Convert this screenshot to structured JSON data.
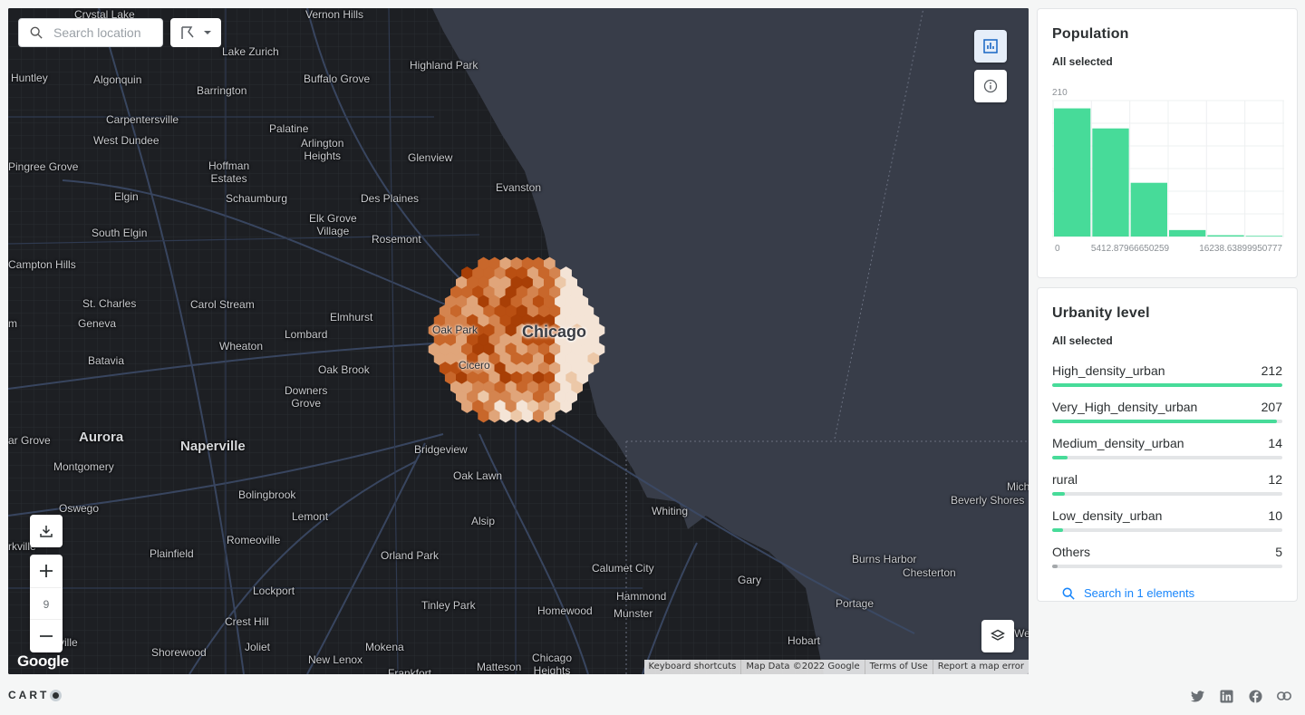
{
  "map": {
    "search_placeholder": "Search location",
    "zoom_level": "9",
    "attribution": [
      "Keyboard shortcuts",
      "Map Data ©2022 Google",
      "Terms of Use",
      "Report a map error"
    ],
    "google_logo": "Google",
    "places": [
      {
        "name": "Crystal Lake",
        "type": "normal"
      },
      {
        "name": "Vernon Hills",
        "type": "normal"
      },
      {
        "name": "Lake Zurich",
        "type": "normal"
      },
      {
        "name": "Highland Park",
        "type": "normal"
      },
      {
        "name": "Huntley",
        "type": "normal"
      },
      {
        "name": "Algonquin",
        "type": "normal"
      },
      {
        "name": "Barrington",
        "type": "normal"
      },
      {
        "name": "Buffalo Grove",
        "type": "normal"
      },
      {
        "name": "Carpentersville",
        "type": "normal"
      },
      {
        "name": "Palatine",
        "type": "normal"
      },
      {
        "name": "West Dundee",
        "type": "normal"
      },
      {
        "name": "Arlington Heights",
        "type": "normal"
      },
      {
        "name": "Glenview",
        "type": "normal"
      },
      {
        "name": "Pingree Grove",
        "type": "normal"
      },
      {
        "name": "Hoffman Estates",
        "type": "normal"
      },
      {
        "name": "Evanston",
        "type": "normal"
      },
      {
        "name": "Elgin",
        "type": "normal"
      },
      {
        "name": "Schaumburg",
        "type": "normal"
      },
      {
        "name": "Des Plaines",
        "type": "normal"
      },
      {
        "name": "Elk Grove Village",
        "type": "normal"
      },
      {
        "name": "South Elgin",
        "type": "normal"
      },
      {
        "name": "Rosemont",
        "type": "normal"
      },
      {
        "name": "Campton Hills",
        "type": "normal"
      },
      {
        "name": "St. Charles",
        "type": "normal"
      },
      {
        "name": "Carol Stream",
        "type": "normal"
      },
      {
        "name": "Elmhurst",
        "type": "normal"
      },
      {
        "name": "Geneva",
        "type": "normal"
      },
      {
        "name": "Oak Park",
        "type": "dark"
      },
      {
        "name": "Chicago",
        "type": "city"
      },
      {
        "name": "Wheaton",
        "type": "normal"
      },
      {
        "name": "Lombard",
        "type": "normal"
      },
      {
        "name": "Batavia",
        "type": "normal"
      },
      {
        "name": "Cicero",
        "type": "dark"
      },
      {
        "name": "Oak Brook",
        "type": "normal"
      },
      {
        "name": "Downers Grove",
        "type": "normal"
      },
      {
        "name": "Aurora",
        "type": "big"
      },
      {
        "name": "Naperville",
        "type": "big"
      },
      {
        "name": "Bridgeview",
        "type": "normal"
      },
      {
        "name": "Montgomery",
        "type": "normal"
      },
      {
        "name": "Oak Lawn",
        "type": "normal"
      },
      {
        "name": "Bolingbrook",
        "type": "normal"
      },
      {
        "name": "Oswego",
        "type": "normal"
      },
      {
        "name": "Lemont",
        "type": "normal"
      },
      {
        "name": "Alsip",
        "type": "normal"
      },
      {
        "name": "Whiting",
        "type": "normal"
      },
      {
        "name": "Beverly Shores",
        "type": "normal"
      },
      {
        "name": "Romeoville",
        "type": "normal"
      },
      {
        "name": "Plainfield",
        "type": "normal"
      },
      {
        "name": "Orland Park",
        "type": "normal"
      },
      {
        "name": "Calumet City",
        "type": "normal"
      },
      {
        "name": "Burns Harbor",
        "type": "normal"
      },
      {
        "name": "Chesterton",
        "type": "normal"
      },
      {
        "name": "Gary",
        "type": "normal"
      },
      {
        "name": "Lockport",
        "type": "normal"
      },
      {
        "name": "Hammond",
        "type": "normal"
      },
      {
        "name": "Tinley Park",
        "type": "normal"
      },
      {
        "name": "Homewood",
        "type": "normal"
      },
      {
        "name": "Munster",
        "type": "normal"
      },
      {
        "name": "Portage",
        "type": "normal"
      },
      {
        "name": "Crest Hill",
        "type": "normal"
      },
      {
        "name": "Joliet",
        "type": "normal"
      },
      {
        "name": "Shorewood",
        "type": "normal"
      },
      {
        "name": "Mokena",
        "type": "normal"
      },
      {
        "name": "Hobart",
        "type": "normal"
      },
      {
        "name": "New Lenox",
        "type": "normal"
      },
      {
        "name": "Matteson",
        "type": "normal"
      },
      {
        "name": "Chicago Heights",
        "type": "normal"
      },
      {
        "name": "Frankfort",
        "type": "normal"
      },
      {
        "name": "ar Grove",
        "type": "normal"
      },
      {
        "name": "rkville",
        "type": "normal"
      },
      {
        "name": "ville",
        "type": "normal"
      },
      {
        "name": "Mich",
        "type": "normal"
      },
      {
        "name": "We",
        "type": "normal"
      },
      {
        "name": "m",
        "type": "normal"
      }
    ],
    "colors": {
      "water": "#383d49",
      "land": "#1d1f23",
      "hex_light": "#f4e4d6",
      "hex_dark": "#a83f06"
    }
  },
  "population": {
    "title": "Population",
    "subtitle": "All selected",
    "chart_data": {
      "type": "bar",
      "y_max_label": "210",
      "x_tick_labels": [
        "0",
        "5412.87966650259",
        "16238.63899950777"
      ],
      "values": [
        198,
        167,
        83,
        10,
        2,
        1
      ],
      "ylim": [
        0,
        210
      ],
      "color": "#47db99"
    }
  },
  "urbanity": {
    "title": "Urbanity level",
    "subtitle": "All selected",
    "chart_data": {
      "type": "bar",
      "categories": [
        "High_density_urban",
        "Very_High_density_urban",
        "Medium_density_urban",
        "rural",
        "Low_density_urban",
        "Others"
      ],
      "values": [
        212,
        207,
        14,
        12,
        10,
        5
      ],
      "max": 212
    },
    "search_link": "Search in 1 elements"
  },
  "footer": {
    "brand": "CART"
  }
}
